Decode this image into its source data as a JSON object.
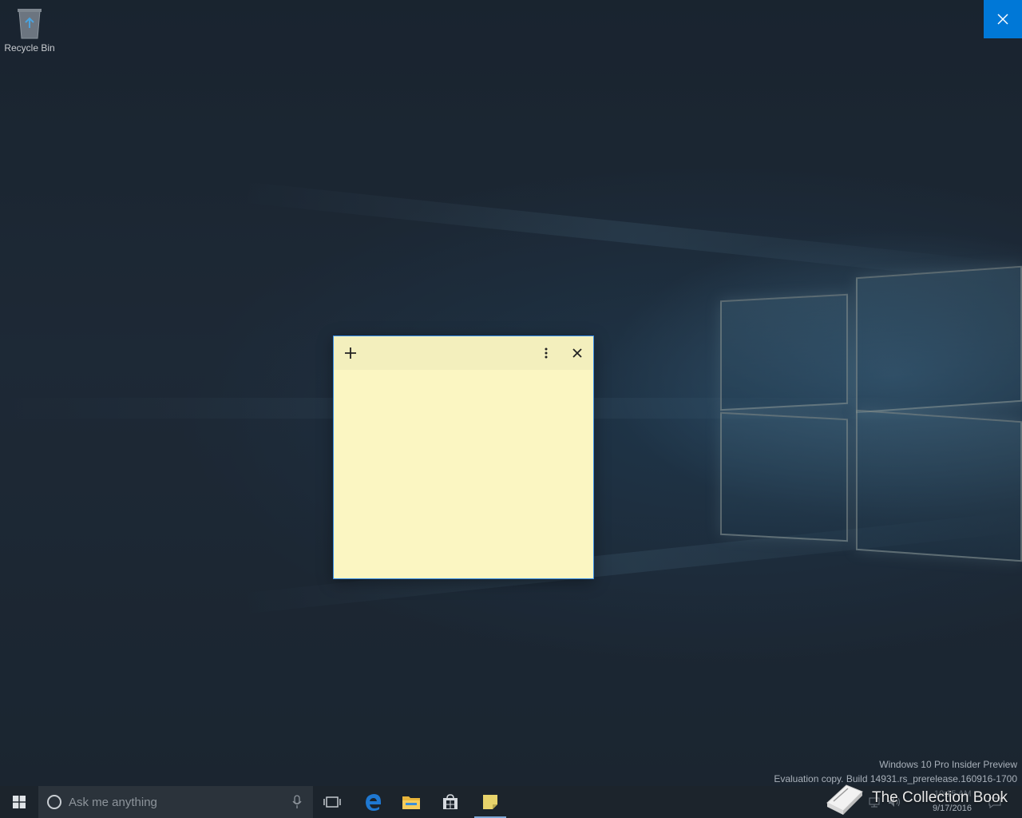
{
  "desktop": {
    "recycle_bin_label": "Recycle Bin"
  },
  "overlay": {
    "close_icon": "close-icon"
  },
  "sticky_note": {
    "add_icon": "plus-icon",
    "menu_icon": "more-vertical-icon",
    "close_icon": "close-icon",
    "body_text": "",
    "colors": {
      "body": "#fbf6c2",
      "header": "#f3efbd",
      "border": "#3a8ee6"
    }
  },
  "watermark": {
    "line1": "Windows 10 Pro Insider Preview",
    "line2": "Evaluation copy. Build 14931.rs_prerelease.160916-1700"
  },
  "taskbar": {
    "start_icon": "windows-start-icon",
    "search_placeholder": "Ask me anything",
    "mic_icon": "microphone-icon",
    "task_view_icon": "task-view-icon",
    "pinned": [
      "edge-icon",
      "file-explorer-icon",
      "store-icon",
      "sticky-notes-icon"
    ],
    "active_app": "sticky-notes-icon",
    "clock_time": "10:15 AM",
    "clock_date": "9/17/2016"
  },
  "brand_overlay": {
    "text": "The Collection Book"
  },
  "colors": {
    "accent": "#0078d7",
    "taskbar": "#1c242c"
  }
}
